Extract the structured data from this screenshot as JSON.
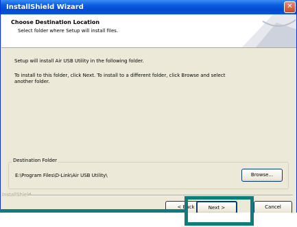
{
  "window": {
    "title": "InstallShield Wizard",
    "close_glyph": "✕"
  },
  "header": {
    "title": "Choose Destination Location",
    "subtitle": "Select folder where Setup will install files."
  },
  "body": {
    "line1": "Setup will install Air USB Utility in the following folder.",
    "line2a": "To install to this folder, click Next. To install to a different folder, click Browse and select",
    "line2b": "another folder."
  },
  "destination": {
    "group_label": "Destination Folder",
    "path": "E:\\Program Files\\D-Link\\Air USB Utility\\",
    "browse_label": "Browse..."
  },
  "footer": {
    "installshield_label": "InstallShield",
    "back_label": "< Back",
    "next_label": "Next >",
    "cancel_label": "Cancel"
  },
  "colors": {
    "highlight": "#0e7c78",
    "titlebar": "#0a54dd"
  }
}
